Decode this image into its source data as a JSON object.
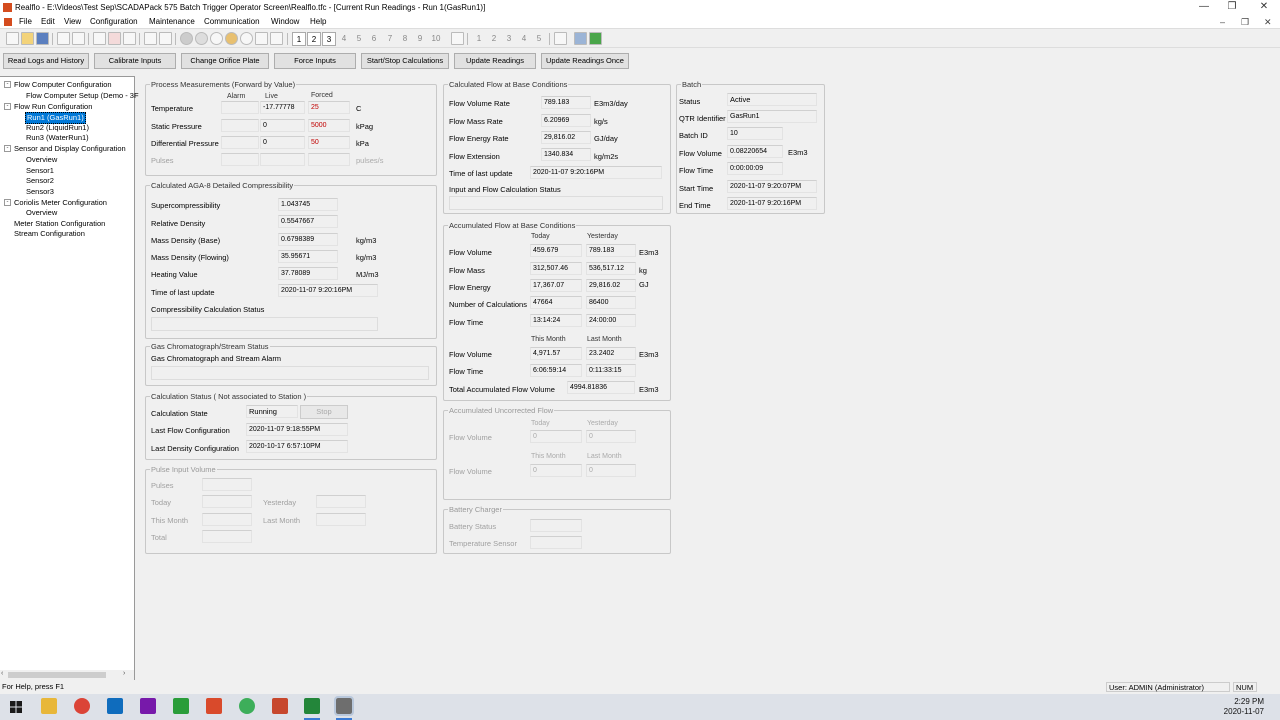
{
  "window": {
    "title": "Realflo - E:\\Videos\\Test Sep\\SCADAPack 575 Batch Trigger Operator Screen\\Realflo.tfc - [Current Run Readings - Run 1(GasRun1)]",
    "minimize": "—",
    "restore": "❐",
    "close": "✕",
    "child_restore": "❐",
    "child_close": "✕",
    "child_min": "–"
  },
  "menu": [
    "File",
    "Edit",
    "View",
    "Configuration",
    "Maintenance",
    "Communication",
    "Window",
    "Help"
  ],
  "toolbar": {
    "run_buttons": [
      "1",
      "2",
      "3",
      "4",
      "5",
      "6",
      "7",
      "8",
      "9",
      "10"
    ],
    "stream_buttons": [
      "1",
      "2",
      "3",
      "4",
      "5"
    ]
  },
  "buttons": [
    "Read Logs and History",
    "Calibrate Inputs",
    "Change Orifice Plate",
    "Force Inputs",
    "Start/Stop Calculations",
    "Update Readings",
    "Update Readings Once"
  ],
  "tree": [
    {
      "label": "Flow Computer Configuration",
      "level": 0,
      "exp": "-"
    },
    {
      "label": "Flow Computer Setup (Demo - 3F",
      "level": 1
    },
    {
      "label": "Flow Run Configuration",
      "level": 0,
      "exp": "-"
    },
    {
      "label": "Run1 (GasRun1)",
      "level": 1,
      "selected": true
    },
    {
      "label": "Run2 (LiquidRun1)",
      "level": 1
    },
    {
      "label": "Run3 (WaterRun1)",
      "level": 1
    },
    {
      "label": "Sensor and Display Configuration",
      "level": 0,
      "exp": "-"
    },
    {
      "label": "Overview",
      "level": 1
    },
    {
      "label": "Sensor1",
      "level": 1
    },
    {
      "label": "Sensor2",
      "level": 1
    },
    {
      "label": "Sensor3",
      "level": 1
    },
    {
      "label": "Coriolis Meter Configuration",
      "level": 0,
      "exp": "-"
    },
    {
      "label": "Overview",
      "level": 1
    },
    {
      "label": "Meter Station Configuration",
      "level": 0
    },
    {
      "label": "Stream Configuration",
      "level": 0
    }
  ],
  "process": {
    "title": "Process Measurements (Forward by Value)",
    "h_alarm": "Alarm",
    "h_live": "Live",
    "h_forced": "Forced",
    "rows": [
      {
        "label": "Temperature",
        "live": "-17.77778",
        "forced": "25",
        "unit": "C"
      },
      {
        "label": "Static Pressure",
        "live": "0",
        "forced": "5000",
        "unit": "kPag"
      },
      {
        "label": "Differential Pressure",
        "live": "0",
        "forced": "50",
        "unit": "kPa"
      },
      {
        "label": "Pulses",
        "live": "",
        "forced": "",
        "unit": "pulses/s"
      }
    ]
  },
  "aga8": {
    "title": "Calculated AGA-8 Detailed Compressibility",
    "rows": [
      {
        "label": "Supercompressibility",
        "value": "1.043745",
        "unit": ""
      },
      {
        "label": "Relative Density",
        "value": "0.5547667",
        "unit": ""
      },
      {
        "label": "Mass Density (Base)",
        "value": "0.6798389",
        "unit": "kg/m3"
      },
      {
        "label": "Mass Density (Flowing)",
        "value": "35.95671",
        "unit": "kg/m3"
      },
      {
        "label": "Heating Value",
        "value": "37.78089",
        "unit": "MJ/m3"
      },
      {
        "label": "Time of last update",
        "value": "2020-11-07 9:20:16PM",
        "unit": ""
      }
    ],
    "status_label": "Compressibility Calculation Status"
  },
  "gc": {
    "title": "Gas Chromatograph/Stream Status",
    "label": "Gas Chromatograph and Stream Alarm"
  },
  "calc": {
    "title": "Calculation Status ( Not associated to Station )",
    "state_label": "Calculation State",
    "state": "Running",
    "stop": "Stop",
    "flow_cfg_label": "Last Flow Configuration",
    "flow_cfg": "2020-11-07 9:18:55PM",
    "dens_cfg_label": "Last Density Configuration",
    "dens_cfg": "2020-10-17 6:57:10PM"
  },
  "pulse": {
    "title": "Pulse Input Volume",
    "pulses": "Pulses",
    "today": "Today",
    "yesterday": "Yesterday",
    "this_month": "This Month",
    "last_month": "Last Month",
    "total": "Total"
  },
  "base": {
    "title": "Calculated Flow at Base Conditions",
    "rows": [
      {
        "label": "Flow Volume Rate",
        "value": "789.183",
        "unit": "E3m3/day"
      },
      {
        "label": "Flow Mass Rate",
        "value": "6.20969",
        "unit": "kg/s"
      },
      {
        "label": "Flow Energy Rate",
        "value": "29,816.02",
        "unit": "GJ/day"
      },
      {
        "label": "Flow Extension",
        "value": "1340.834",
        "unit": "kg/m2s"
      },
      {
        "label": "Time of last update",
        "value": "2020-11-07 9:20:16PM",
        "unit": ""
      }
    ],
    "status_label": "Input and Flow Calculation Status"
  },
  "accum": {
    "title": "Accumulated Flow at Base Conditions",
    "h_today": "Today",
    "h_yesterday": "Yesterday",
    "h_this_month": "This Month",
    "h_last_month": "Last Month",
    "rows": [
      {
        "label": "Flow Volume",
        "today": "459.679",
        "yesterday": "789.183",
        "unit": "E3m3"
      },
      {
        "label": "Flow Mass",
        "today": "312,507.46",
        "yesterday": "536,517.12",
        "unit": "kg"
      },
      {
        "label": "Flow Energy",
        "today": "17,367.07",
        "yesterday": "29,816.02",
        "unit": "GJ"
      },
      {
        "label": "Number of Calculations",
        "today": "47664",
        "yesterday": "86400",
        "unit": ""
      },
      {
        "label": "Flow Time",
        "today": "13:14:24",
        "yesterday": "24:00:00",
        "unit": ""
      }
    ],
    "month_rows": [
      {
        "label": "Flow Volume",
        "this": "4,971.57",
        "last": "23.2402",
        "unit": "E3m3"
      },
      {
        "label": "Flow Time",
        "this": "6:06:59:14",
        "last": "0:11:33:15",
        "unit": ""
      }
    ],
    "total_label": "Total Accumulated Flow Volume",
    "total": "4994.81836",
    "total_unit": "E3m3"
  },
  "uncorr": {
    "title": "Accumulated Uncorrected Flow",
    "h_today": "Today",
    "h_yesterday": "Yesterday",
    "h_this_month": "This Month",
    "h_last_month": "Last Month",
    "flow_volume": "Flow Volume",
    "v1": "0",
    "v2": "0",
    "v3": "0",
    "v4": "0"
  },
  "battery": {
    "title": "Battery Charger",
    "status": "Battery Status",
    "sensor": "Temperature Sensor"
  },
  "batch": {
    "title": "Batch",
    "rows": [
      {
        "label": "Status",
        "value": "Active",
        "unit": ""
      },
      {
        "label": "QTR Identifier",
        "value": "GasRun1",
        "unit": ""
      },
      {
        "label": "Batch ID",
        "value": "10",
        "unit": ""
      },
      {
        "label": "Flow Volume",
        "value": "0.08220654",
        "unit": "E3m3"
      },
      {
        "label": "Flow Time",
        "value": "0:00:00:09",
        "unit": ""
      },
      {
        "label": "Start Time",
        "value": "2020-11-07 9:20:07PM",
        "unit": ""
      },
      {
        "label": "End Time",
        "value": "2020-11-07 9:20:16PM",
        "unit": ""
      }
    ]
  },
  "status": {
    "help": "For Help, press F1",
    "user": "User: ADMIN (Administrator)",
    "num": "NUM"
  },
  "taskbar": {
    "time": "2:29 PM",
    "date": "2020-11-07"
  }
}
